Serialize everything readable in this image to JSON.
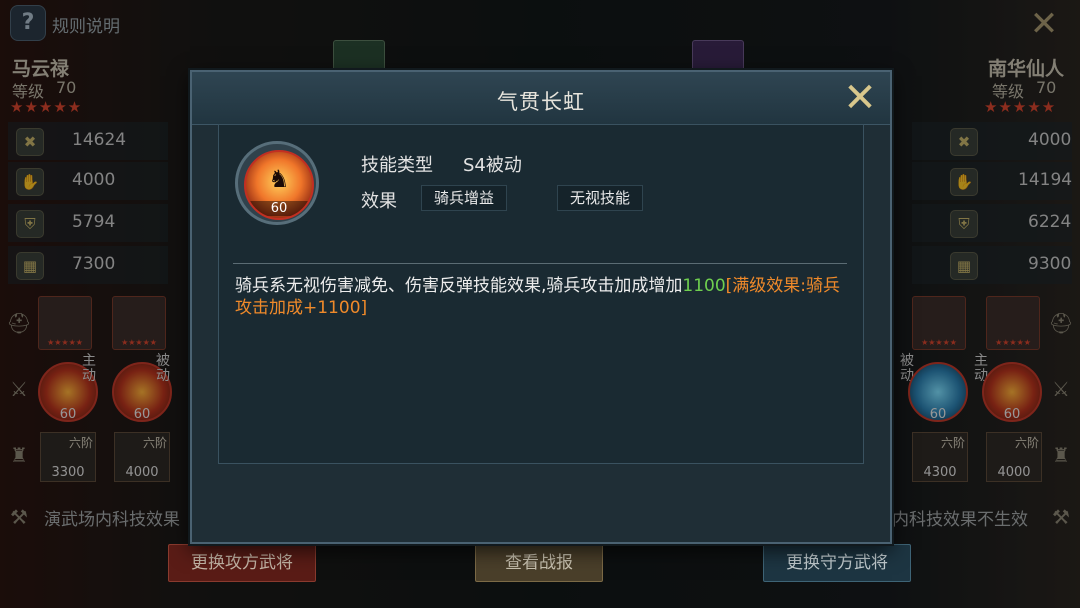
{
  "topbar": {
    "help_icon": "?",
    "help_text": "规则说明",
    "close_icon": "close-x"
  },
  "attacker": {
    "name": "马云禄",
    "level_label": "等级",
    "level": "70",
    "stars": "★★★★★",
    "stats": [
      {
        "icon": "attack-icon",
        "glyph": "✖",
        "value": "14624"
      },
      {
        "icon": "strategy-icon",
        "glyph": "✋",
        "value": "4000"
      },
      {
        "icon": "defense-icon",
        "glyph": "⛨",
        "value": "5794"
      },
      {
        "icon": "troops-icon",
        "glyph": "▦",
        "value": "7300"
      }
    ],
    "skills": [
      {
        "tag": "主动",
        "level": "60"
      },
      {
        "tag": "被动",
        "level": "60"
      }
    ],
    "troops": [
      {
        "tier": "六阶",
        "count": "3300"
      },
      {
        "tier": "六阶",
        "count": "4000"
      }
    ],
    "tech_text": "演武场内科技效果"
  },
  "defender": {
    "name": "南华仙人",
    "level_label": "等级",
    "level": "70",
    "stars": "★★★★★",
    "stats": [
      {
        "icon": "attack-icon",
        "glyph": "✖",
        "value": "4000"
      },
      {
        "icon": "strategy-icon",
        "glyph": "✋",
        "value": "14194"
      },
      {
        "icon": "defense-icon",
        "glyph": "⛨",
        "value": "6224"
      },
      {
        "icon": "troops-icon",
        "glyph": "▦",
        "value": "9300"
      }
    ],
    "skills": [
      {
        "tag": "被动",
        "level": "60"
      },
      {
        "tag": "主动",
        "level": "60"
      }
    ],
    "troops": [
      {
        "tier": "六阶",
        "count": "4300"
      },
      {
        "tier": "六阶",
        "count": "4000"
      }
    ],
    "tech_text": "内科技效果不生效"
  },
  "bottom_buttons": {
    "change_attacker": "更换攻方武将",
    "view_report": "查看战报",
    "change_defender": "更换守方武将"
  },
  "modal": {
    "title": "气贯长虹",
    "close_icon": "close-x",
    "skill_level": "60",
    "skill_type_label": "技能类型",
    "skill_type_value": "S4被动",
    "effect_label": "效果",
    "effect_tags": [
      "骑兵增益",
      "无视技能"
    ],
    "desc_main": "骑兵系无视伤害减免、伤害反弹技能效果,骑兵攻击加成增加",
    "desc_value": "1100",
    "desc_max": "[满级效果:骑兵攻击加成+1100]"
  },
  "colors": {
    "accent_red": "#d8452e",
    "value_green": "#6fcf4f",
    "max_orange": "#f08a2a"
  }
}
